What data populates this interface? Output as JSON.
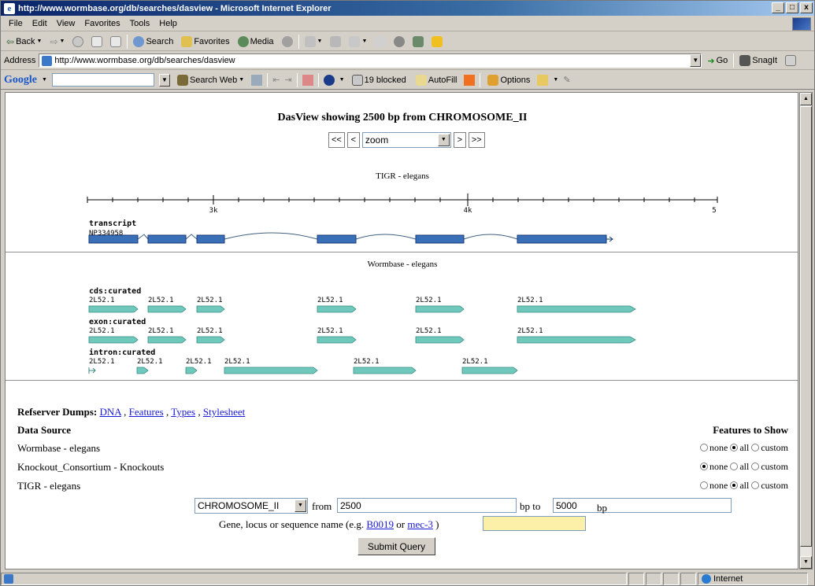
{
  "window": {
    "title": "http://www.wormbase.org/db/searches/dasview - Microsoft Internet Explorer",
    "min": "_",
    "max": "□",
    "close": "x"
  },
  "menu": [
    "File",
    "Edit",
    "View",
    "Favorites",
    "Tools",
    "Help"
  ],
  "toolbar": {
    "back": "Back",
    "search": "Search",
    "favorites": "Favorites",
    "media": "Media"
  },
  "address": {
    "label": "Address",
    "url": "http://www.wormbase.org/db/searches/dasview",
    "go": "Go",
    "snagit": "SnagIt"
  },
  "google": {
    "logo": "Google",
    "search_web": "Search Web",
    "blocked": "19 blocked",
    "autofill": "AutoFill",
    "options": "Options"
  },
  "page": {
    "title": "DasView showing 2500 bp from CHROMOSOME_II",
    "nav": {
      "far_left": "<<",
      "left": "<",
      "zoom": "zoom",
      "right": ">",
      "far_right": ">>"
    },
    "track1": {
      "title": "TIGR - elegans",
      "ruler_labels": [
        "3k",
        "4k",
        "5"
      ],
      "feature_type": "transcript",
      "feature_name": "NP334958"
    },
    "track2": {
      "title": "Wormbase - elegans",
      "groups": [
        {
          "type": "cds:curated",
          "labels": [
            "2L52.1",
            "2L52.1",
            "2L52.1",
            "2L52.1",
            "2L52.1",
            "2L52.1"
          ]
        },
        {
          "type": "exon:curated",
          "labels": [
            "2L52.1",
            "2L52.1",
            "2L52.1",
            "2L52.1",
            "2L52.1",
            "2L52.1"
          ]
        },
        {
          "type": "intron:curated",
          "labels": [
            "2L52.1",
            "2L52.1",
            "2L52.1",
            "2L52.1",
            "2L52.1",
            "2L52.1"
          ]
        }
      ]
    },
    "refserver": {
      "label": "Refserver Dumps:",
      "links": [
        "DNA",
        "Features",
        "Types",
        "Stylesheet"
      ],
      "separators": [
        ",",
        ",",
        ","
      ]
    },
    "data_source_header": "Data Source",
    "features_header": "Features to Show",
    "sources": [
      {
        "name": "Wormbase - elegans",
        "selected": "all"
      },
      {
        "name": "Knockout_Consortium - Knockouts",
        "selected": "none"
      },
      {
        "name": "TIGR - elegans",
        "selected": "all"
      }
    ],
    "radio_options": [
      "none",
      "all",
      "custom"
    ],
    "form": {
      "chromosome": "CHROMOSOME_II",
      "from_label": "from",
      "from_value": "2500",
      "to_label": "bp to",
      "to_value": "5000",
      "bp_label": "bp",
      "gene_label_pre": "Gene, locus or sequence name (e.g.",
      "example1": "B0019",
      "or": "or",
      "example2": "mec-3",
      "gene_label_post": ")",
      "submit": "Submit Query"
    }
  },
  "status": {
    "zone": "Internet"
  }
}
